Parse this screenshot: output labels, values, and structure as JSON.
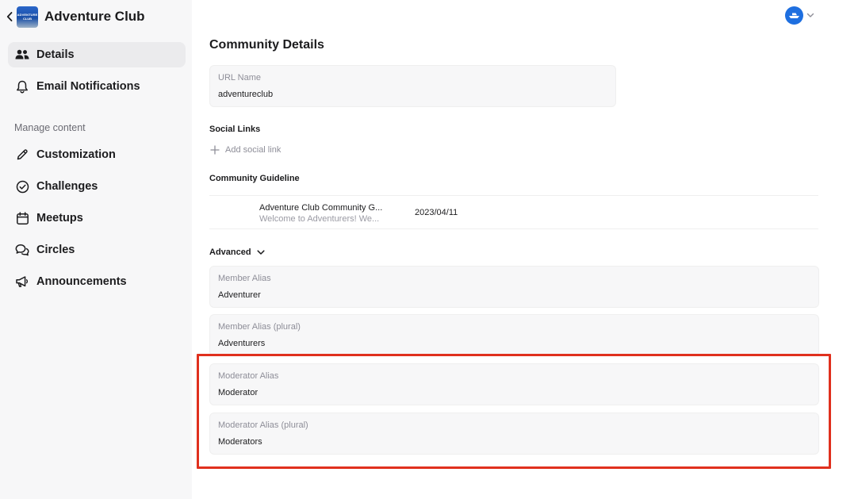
{
  "sidebar": {
    "brand": {
      "name": "Adventure Club",
      "logo_text_top": "ADVENTURE",
      "logo_text_bottom": "CLUB"
    },
    "items": [
      {
        "label": "Details",
        "icon": "users-icon"
      },
      {
        "label": "Email Notifications",
        "icon": "bell-icon"
      }
    ],
    "section_label": "Manage content",
    "content_items": [
      {
        "label": "Customization",
        "icon": "pencil-icon"
      },
      {
        "label": "Challenges",
        "icon": "check-circle-icon"
      },
      {
        "label": "Meetups",
        "icon": "calendar-icon"
      },
      {
        "label": "Circles",
        "icon": "chat-bubbles-icon"
      },
      {
        "label": "Announcements",
        "icon": "megaphone-icon"
      }
    ]
  },
  "header": {
    "avatar_icon": "boat-icon",
    "menu_icon": "chevron-down-icon"
  },
  "main": {
    "title": "Community Details",
    "url_field": {
      "label": "URL Name",
      "value": "adventureclub"
    },
    "social": {
      "heading": "Social Links",
      "add_label": "Add social link"
    },
    "guideline": {
      "heading": "Community Guideline",
      "title": "Adventure Club Community G...",
      "preview": "Welcome to Adventurers! We...",
      "date": "2023/04/11"
    },
    "advanced": {
      "label": "Advanced",
      "fields": [
        {
          "label": "Member Alias",
          "value": "Adventurer"
        },
        {
          "label": "Member Alias (plural)",
          "value": "Adventurers"
        },
        {
          "label": "Moderator Alias",
          "value": "Moderator"
        },
        {
          "label": "Moderator Alias (plural)",
          "value": "Moderators"
        }
      ]
    }
  },
  "colors": {
    "accent": "#1e6fe0",
    "highlight": "#e0301e",
    "sidebar_bg": "#f7f7f8"
  }
}
